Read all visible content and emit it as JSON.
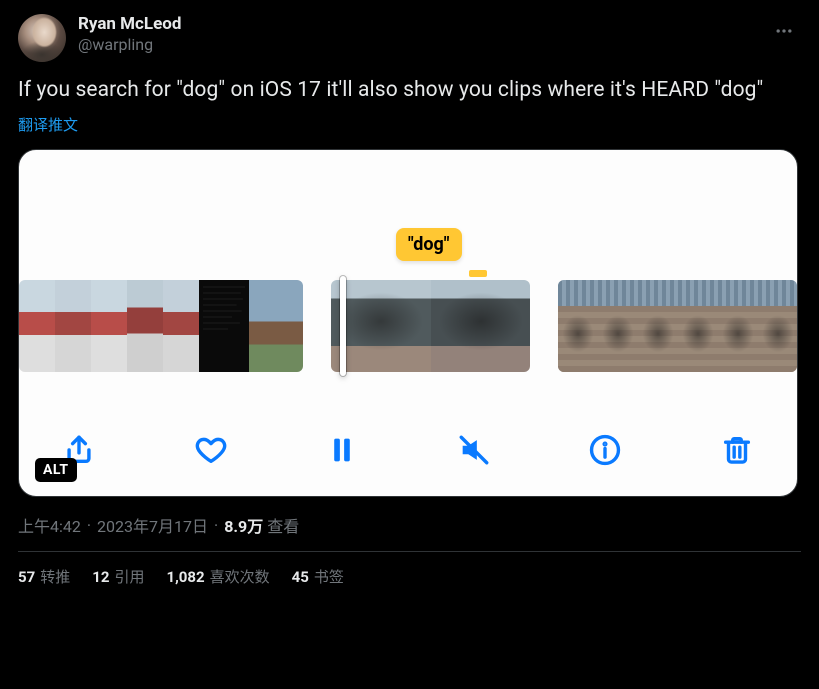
{
  "author": {
    "display_name": "Ryan McLeod",
    "handle": "@warpling"
  },
  "tweet_text": "If you search for \"dog\" on iOS 17 it'll also show you clips where it's HEARD \"dog\"",
  "translate_label": "翻译推文",
  "media": {
    "tooltip_text": "\"dog\"",
    "alt_badge": "ALT"
  },
  "meta": {
    "time": "上午4:42",
    "date": "2023年7月17日",
    "views_count": "8.9万",
    "views_label": "查看"
  },
  "stats": {
    "retweets_count": "57",
    "retweets_label": "转推",
    "quotes_count": "12",
    "quotes_label": "引用",
    "likes_count": "1,082",
    "likes_label": "喜欢次数",
    "bookmarks_count": "45",
    "bookmarks_label": "书签"
  }
}
